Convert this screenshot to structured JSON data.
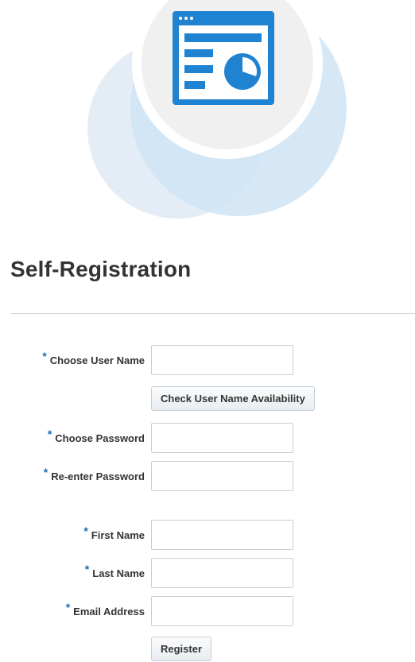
{
  "header": {
    "logo_icon": "dashboard-window-icon"
  },
  "page": {
    "title": "Self-Registration"
  },
  "form": {
    "required_marker": "*",
    "username_label": "Choose User Name",
    "username_value": "",
    "check_availability_label": "Check User Name Availability",
    "password_label": "Choose Password",
    "password_value": "",
    "reenter_password_label": "Re-enter Password",
    "reenter_password_value": "",
    "first_name_label": "First Name",
    "first_name_value": "",
    "last_name_label": "Last Name",
    "last_name_value": "",
    "email_label": "Email Address",
    "email_value": "",
    "register_label": "Register"
  },
  "colors": {
    "accent_blue": "#1f83d1",
    "required_blue": "#1f6bb5",
    "circle_light": "#e8eff7",
    "circle_medium": "#d6e8f6"
  }
}
